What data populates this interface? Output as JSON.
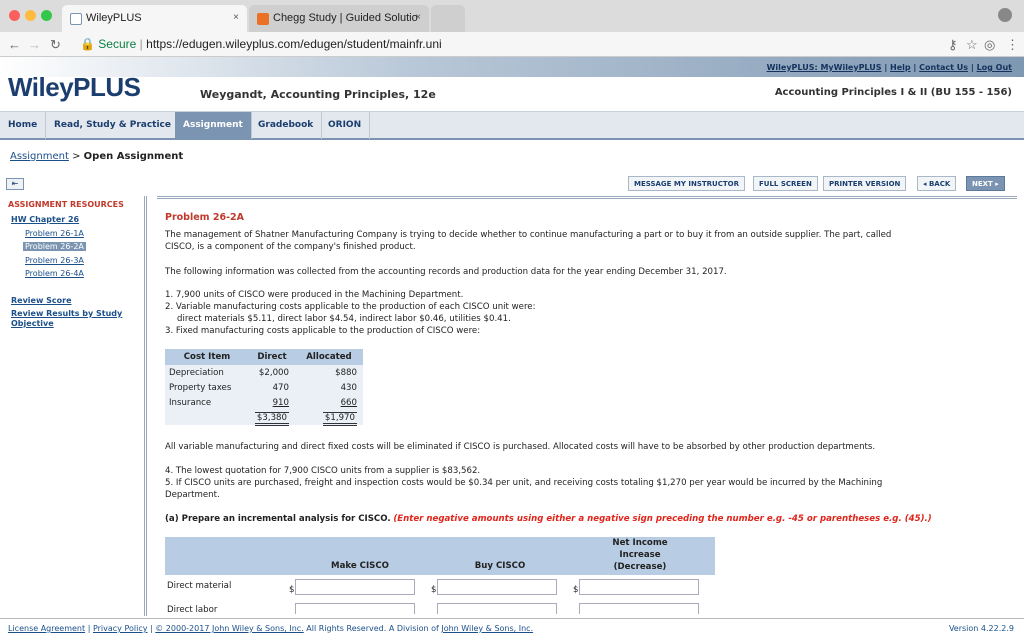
{
  "browser": {
    "tabs": [
      {
        "label": "WileyPLUS",
        "active": true
      },
      {
        "label": "Chegg Study | Guided Solutio",
        "active": false
      }
    ],
    "close_glyph": "×",
    "secure_label": "Secure",
    "url": "https://edugen.wileyplus.com/edugen/student/mainfr.uni"
  },
  "header": {
    "links": [
      "WileyPLUS: MyWileyPLUS",
      "Help",
      "Contact Us",
      "Log Out"
    ],
    "logo": "WileyPLUS",
    "book_title": "Weygandt, Accounting Principles, 12e",
    "course": "Accounting Principles I & II (BU 155 - 156)"
  },
  "nav": {
    "items": [
      "Home",
      "Read, Study & Practice",
      "Assignment",
      "Gradebook",
      "ORION"
    ],
    "active": "Assignment"
  },
  "breadcrumb": {
    "link": "Assignment",
    "sep": ">",
    "current": "Open Assignment"
  },
  "toolbar": {
    "message": "MESSAGE MY INSTRUCTOR",
    "fullscreen": "FULL SCREEN",
    "printer": "PRINTER VERSION",
    "back": "◂ BACK",
    "next": "NEXT ▸"
  },
  "sidebar": {
    "heading": "ASSIGNMENT RESOURCES",
    "chapter": "HW Chapter 26",
    "problems": [
      "Problem 26-1A",
      "Problem 26-2A",
      "Problem 26-3A",
      "Problem 26-4A"
    ],
    "selected": "Problem 26-2A",
    "review_score": "Review Score",
    "review_results": "Review Results by Study",
    "review_results_2": "Objective"
  },
  "problem": {
    "title": "Problem 26-2A",
    "intro1": "The management of Shatner Manufacturing Company is trying to decide whether to continue manufacturing a part or to buy it from an outside supplier. The part, called",
    "intro2": "CISCO, is a component of the company's finished product.",
    "info": "The following information was collected from the accounting records and production data for the year ending December 31, 2017.",
    "item1": "1. 7,900 units of CISCO were produced in the Machining Department.",
    "item2": "2. Variable manufacturing costs applicable to the production of each CISCO unit were:",
    "item2b": "direct materials $5.11, direct labor $4.54, indirect labor $0.46, utilities $0.41.",
    "item3": "3. Fixed manufacturing costs applicable to the production of CISCO were:",
    "table": {
      "headers": [
        "Cost Item",
        "Direct",
        "Allocated"
      ],
      "rows": [
        [
          "Depreciation",
          "$2,000",
          "$880"
        ],
        [
          "Property taxes",
          "470",
          "430"
        ],
        [
          "Insurance",
          "910",
          "660"
        ]
      ],
      "totals": [
        "",
        "$3,380",
        "$1,970"
      ]
    },
    "note": "All variable manufacturing and direct fixed costs will be eliminated if CISCO is purchased. Allocated costs will have to be absorbed by other production departments.",
    "item4": "4. The lowest quotation for 7,900 CISCO units from a supplier is $83,562.",
    "item5": "5. If CISCO units are purchased, freight and inspection costs would be $0.34 per unit, and receiving costs totaling $1,270 per year would be incurred by the Machining",
    "item5b": "Department.",
    "part_a": "(a) Prepare an incremental analysis for CISCO.",
    "part_a_note": "(Enter negative amounts using either a negative sign preceding the number e.g. -45 or parentheses e.g. (45).)"
  },
  "analysis": {
    "col_make": "Make CISCO",
    "col_buy": "Buy CISCO",
    "col_net1": "Net Income",
    "col_net2": "Increase",
    "col_net3": "(Decrease)",
    "rows": [
      "Direct material",
      "Direct labor"
    ],
    "currency": "$"
  },
  "footer": {
    "license": "License Agreement",
    "privacy": "Privacy Policy",
    "copyright": "© 2000-2017 John Wiley & Sons, Inc.",
    "rights": "All Rights Reserved. A Division of",
    "company": "John Wiley & Sons, Inc.",
    "version": "Version 4.22.2.9"
  },
  "colors": {
    "brand": "#1b3e6f",
    "accent": "#7a94b1",
    "alert": "#c0392b"
  }
}
